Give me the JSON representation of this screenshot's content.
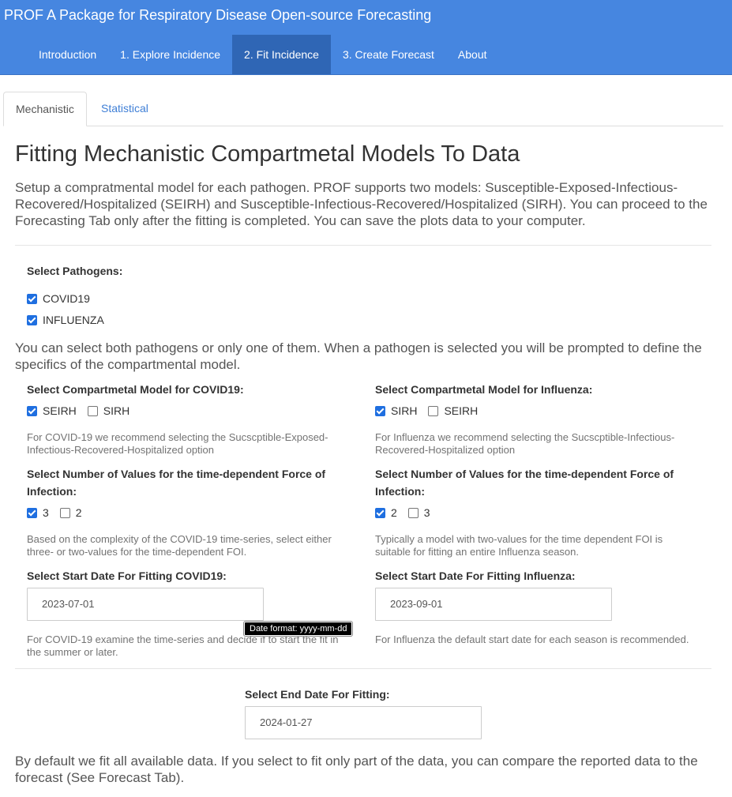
{
  "app": {
    "title": "PROF A Package for Respiratory Disease Open-source Forecasting"
  },
  "nav": {
    "items": [
      {
        "label": "Introduction"
      },
      {
        "label": "1. Explore Incidence"
      },
      {
        "label": "2. Fit Incidence"
      },
      {
        "label": "3. Create Forecast"
      },
      {
        "label": "About"
      }
    ],
    "active": "2. Fit Incidence"
  },
  "tabs": {
    "mechanistic": "Mechanistic",
    "statistical": "Statistical",
    "active": "Mechanistic"
  },
  "page": {
    "title": "Fitting Mechanistic Compartmetal Models To Data",
    "intro": "Setup a compratmental model for each pathogen. PROF supports two models: Susceptible-Exposed-Infectious-Recovered/Hospitalized (SEIRH) and Susceptible-Infectious-Recovered/Hospitalized (SIRH). You can proceed to the Forecasting Tab only after the fitting is completed. You can save the plots data to your computer."
  },
  "pathogens": {
    "label": "Select Pathogens:",
    "options": [
      {
        "label": "COVID19",
        "checked": true
      },
      {
        "label": "INFLUENZA",
        "checked": true
      }
    ],
    "note": "You can select both pathogens or only one of them. When a pathogen is selected you will be prompted to define the specifics of the compartmental model."
  },
  "covid": {
    "model_label": "Select Compartmetal Model for COVID19:",
    "model_options": [
      {
        "label": "SEIRH",
        "checked": true
      },
      {
        "label": "SIRH",
        "checked": false
      }
    ],
    "model_help": "For COVID-19 we recommend selecting the Sucscptible-Exposed-Infectious-Recovered-Hospitalized option",
    "foi_label": "Select Number of Values for the time-dependent Force of Infection:",
    "foi_options": [
      {
        "label": "3",
        "checked": true
      },
      {
        "label": "2",
        "checked": false
      }
    ],
    "foi_help": "Based on the complexity of the COVID-19 time-series, select either three- or two-values for the time-dependent FOI.",
    "start_label": "Select Start Date For Fitting COVID19:",
    "start_value": "2023-07-01",
    "start_help": "For COVID-19 examine the time-series and decide if to start the fit in the summer or later."
  },
  "flu": {
    "model_label": "Select Compartmetal Model for Influenza:",
    "model_options": [
      {
        "label": "SIRH",
        "checked": true
      },
      {
        "label": "SEIRH",
        "checked": false
      }
    ],
    "model_help": "For Influenza we recommend selecting the Sucscptible-Infectious-Recovered-Hospitalized option",
    "foi_label": "Select Number of Values for the time-dependent Force of Infection:",
    "foi_options": [
      {
        "label": "2",
        "checked": true
      },
      {
        "label": "3",
        "checked": false
      }
    ],
    "foi_help": "Typically a model with two-values for the time dependent FOI is suitable for fitting an entire Influenza season.",
    "start_label": "Select Start Date For Fitting Influenza:",
    "start_value": "2023-09-01",
    "start_help": "For Influenza the default start date for each season is recommended."
  },
  "tooltip": {
    "text": "Date format: yyyy-mm-dd"
  },
  "end_date": {
    "label": "Select End Date For Fitting:",
    "value": "2024-01-27",
    "note": "By default we fit all available data. If you select to fit only part of the data, you can compare the reported data to the forecast (See Forecast Tab)."
  },
  "colors": {
    "header": "#4686e0",
    "nav_active": "#2f66b5",
    "link": "#3f7fd6",
    "checkbox": "#1f6fe0"
  }
}
